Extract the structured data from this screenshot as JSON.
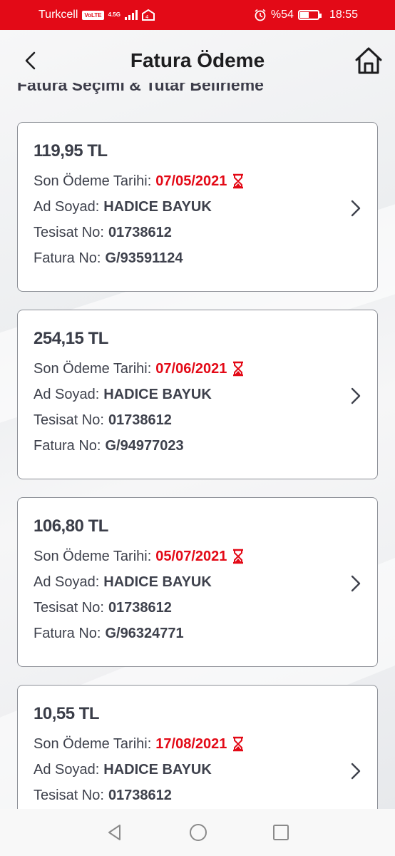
{
  "status_bar": {
    "carrier": "Turkcell",
    "volte": "VoLTE",
    "network": "4.5G",
    "battery_percent": "%54",
    "time": "18:55"
  },
  "header": {
    "title": "Fatura Ödeme"
  },
  "section_title": "Fatura Seçimi & Tutar Belirleme",
  "labels": {
    "due_date": "Son Ödeme Tarihi:",
    "name": "Ad Soyad:",
    "installation": "Tesisat No:",
    "invoice": "Fatura No:"
  },
  "bills": [
    {
      "amount": "119,95 TL",
      "due_date": "07/05/2021",
      "name": "HADICE BAYUK",
      "installation": "01738612",
      "invoice": "G/93591124"
    },
    {
      "amount": "254,15 TL",
      "due_date": "07/06/2021",
      "name": "HADICE BAYUK",
      "installation": "01738612",
      "invoice": "G/94977023"
    },
    {
      "amount": "106,80 TL",
      "due_date": "05/07/2021",
      "name": "HADICE BAYUK",
      "installation": "01738612",
      "invoice": "G/96324771"
    },
    {
      "amount": "10,55 TL",
      "due_date": "17/08/2021",
      "name": "HADICE BAYUK",
      "installation": "01738612",
      "invoice": ""
    }
  ],
  "colors": {
    "brand_red": "#e30a17",
    "text_dark": "#3e414c"
  },
  "icons": [
    "back-arrow-icon",
    "home-icon",
    "hourglass-icon",
    "chevron-right-icon",
    "nav-back-icon",
    "nav-home-icon",
    "nav-recents-icon"
  ]
}
